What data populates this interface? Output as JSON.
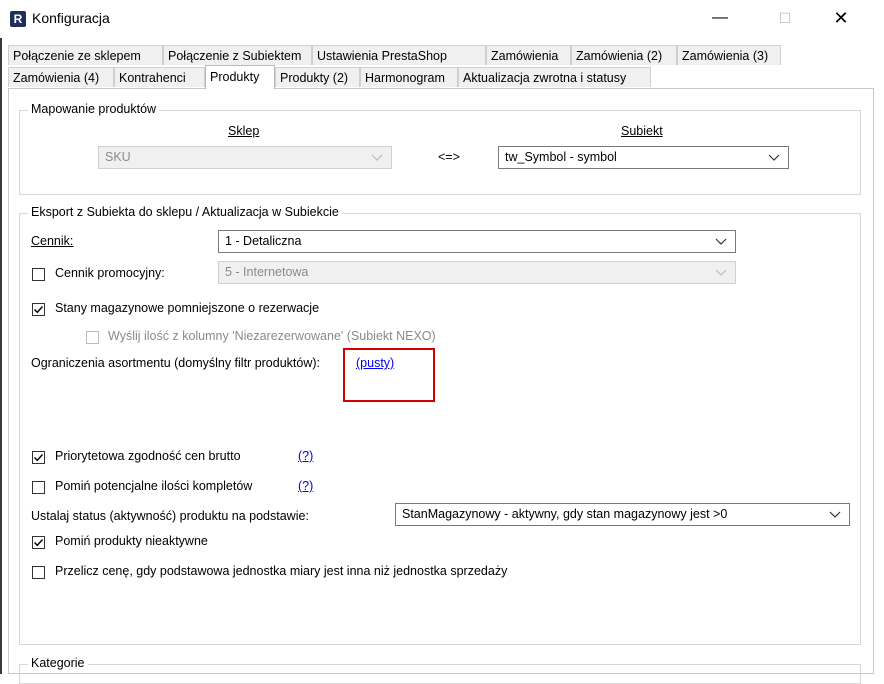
{
  "window": {
    "icon_letter": "R",
    "title": "Konfiguracja",
    "minimize": "—",
    "maximize": "☐",
    "close": "✕"
  },
  "tabs": {
    "row1": [
      "Połączenie ze sklepem",
      "Połączenie z Subiektem",
      "Ustawienia PrestaShop",
      "Zamówienia",
      "Zamówienia (2)",
      "Zamówienia (3)"
    ],
    "row2": [
      "Zamówienia (4)",
      "Kontrahenci",
      "Produkty",
      "Produkty (2)",
      "Harmonogram",
      "Aktualizacja zwrotna i statusy"
    ],
    "active": "Produkty"
  },
  "mapping": {
    "title": "Mapowanie produktów",
    "shop_label": "Sklep",
    "subiekt_label": "Subiekt",
    "shop_value": "SKU",
    "arrow": "<=>",
    "subiekt_value": "tw_Symbol - symbol"
  },
  "export": {
    "title": "Eksport z Subiekta do sklepu / Aktualizacja w Subiekcie",
    "pricelist_label": "Cennik:",
    "pricelist_value": "1 - Detaliczna",
    "promo_label": "Cennik promocyjny:",
    "promo_checked": false,
    "promo_value": "5 - Internetowa",
    "stock_label": "Stany magazynowe pomniejszone o rezerwacje",
    "stock_checked": true,
    "nexo_label": "Wyślij ilość z kolumny 'Niezarezerwowane' (Subiekt NEXO)",
    "nexo_checked": false,
    "restrict_label": "Ograniczenia asortmentu (domyślny filtr produktów):",
    "restrict_link": "(pusty)",
    "gross_label": "Priorytetowa zgodność cen brutto",
    "gross_checked": true,
    "gross_help": "(?)",
    "kits_label": "Pomiń potencjalne ilości kompletów",
    "kits_checked": false,
    "kits_help": "(?)",
    "status_label": "Ustalaj status (aktywność) produktu na podstawie:",
    "status_value": "StanMagazynowy - aktywny, gdy stan magazynowy jest >0",
    "inactive_label": "Pomiń produkty nieaktywne",
    "inactive_checked": true,
    "recalc_label": "Przelicz cenę, gdy podstawowa jednostka miary jest inna niż jednostka sprzedaży",
    "recalc_checked": false
  },
  "categories": {
    "title": "Kategorie"
  },
  "colors": {
    "highlight": "#d40000",
    "link": "#0000ee"
  }
}
